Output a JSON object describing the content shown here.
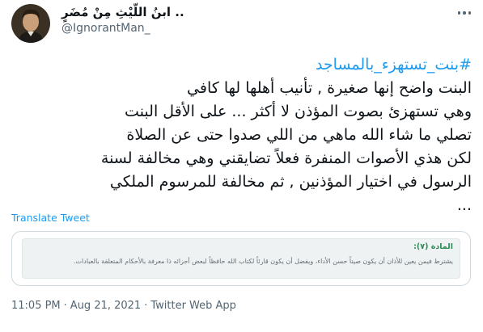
{
  "author": {
    "display_name": "ابنُ اللّيْثِ مِنْ مُضَرٍ ..",
    "handle": "@IgnorantMan_",
    "avatar_icon": "portrait-avatar"
  },
  "more_icon": "more-options-icon",
  "tweet": {
    "hashtag": "#بنت_تستهزء_بالمساجد",
    "lines": [
      "البنت واضح إنها صغيرة , تأنيب أهلها لها كافي",
      "وهي تستهزئ بصوت المؤذن لا أكثر ... على الأقل البنت",
      "تصلي ما شاء الله ماهي من اللي صدوا حتى عن الصلاة",
      "لكن هذي الأصوات المنفرة فعلاً تضايقني وهي مخالفة لسنة",
      "الرسول في اختيار المؤذنين , ثم مخالفة للمرسوم الملكي",
      "..."
    ]
  },
  "translate_label": "Translate Tweet",
  "card": {
    "title": "المادة (٧):",
    "body": "يشترط فيمن يعين للأذان أن يكون صيتاً حسن الأداء، ويفضل أن يكون قارئاً لكتاب الله حافظاً لبعض أجزائه ذا معرفة بالأحكام المتعلقة بالعبادات."
  },
  "meta": {
    "time": "11:05 PM",
    "date": "Aug 21, 2021",
    "source": "Twitter Web App",
    "separator": "·"
  },
  "colors": {
    "link": "#1d9bf0",
    "text": "#0f1419",
    "secondary": "#536471",
    "card_title": "#2e8b57"
  }
}
